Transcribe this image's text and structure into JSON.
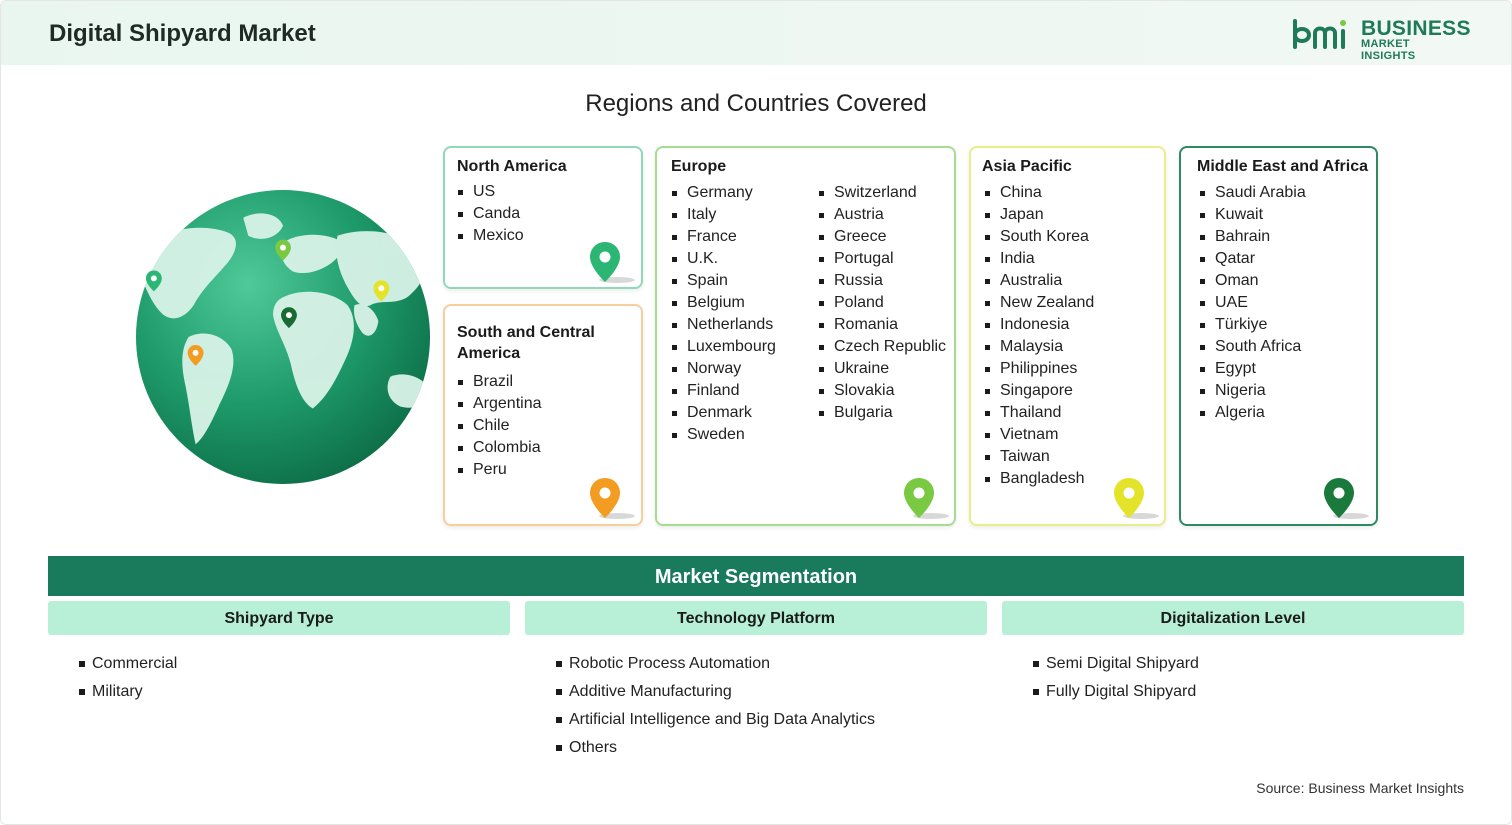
{
  "header": {
    "title": "Digital Shipyard Market",
    "logo_line1": "BUSINESS",
    "logo_line2": "MARKET INSIGHTS"
  },
  "regions_title": "Regions and Countries Covered",
  "regions": {
    "north_america": {
      "title": "North America",
      "items": [
        "US",
        "Canda",
        "Mexico"
      ],
      "pin_color": "#2bb673"
    },
    "south_america": {
      "title": "South and Central America",
      "items": [
        "Brazil",
        "Argentina",
        "Chile",
        "Colombia",
        "Peru"
      ],
      "pin_color": "#f39c22"
    },
    "europe": {
      "title": "Europe",
      "col1": [
        "Germany",
        "Italy",
        "France",
        "U.K.",
        "Spain",
        "Belgium",
        "Netherlands",
        "Luxembourg",
        "Norway",
        "Finland",
        "Denmark",
        "Sweden"
      ],
      "col2": [
        "Switzerland",
        "Austria",
        "Greece",
        "Portugal",
        "Russia",
        "Poland",
        "Romania",
        "Czech Republic",
        "Ukraine",
        "Slovakia",
        "Bulgaria"
      ],
      "pin_color": "#7ac943"
    },
    "asia_pacific": {
      "title": "Asia Pacific",
      "items": [
        "China",
        "Japan",
        "South Korea",
        "India",
        "Australia",
        "New Zealand",
        "Indonesia",
        "Malaysia",
        "Philippines",
        "Singapore",
        "Thailand",
        "Vietnam",
        "Taiwan",
        "Bangladesh"
      ],
      "pin_color": "#e3e32a"
    },
    "mea": {
      "title": "Middle East and Africa",
      "items": [
        "Saudi Arabia",
        "Kuwait",
        "Bahrain",
        "Qatar",
        "Oman",
        "UAE",
        "Türkiye",
        "South Africa",
        "Egypt",
        "Nigeria",
        "Algeria"
      ],
      "pin_color": "#1a7a3c"
    }
  },
  "segmentation": {
    "title": "Market Segmentation",
    "columns": [
      {
        "heading": "Shipyard Type",
        "items": [
          "Commercial",
          "Military"
        ]
      },
      {
        "heading": "Technology Platform",
        "items": [
          "Robotic Process Automation",
          "Additive Manufacturing",
          "Artificial Intelligence and Big Data Analytics",
          "Others"
        ]
      },
      {
        "heading": "Digitalization Level",
        "items": [
          "Semi Digital Shipyard",
          "Fully Digital Shipyard"
        ]
      }
    ]
  },
  "source": "Source: Business Market Insights",
  "colors": {
    "accent": "#1a7a5c",
    "segment_header": "#b7f0d6",
    "card_north_america": "#8fd9b8",
    "card_south_america": "#f6cf9a",
    "card_europe": "#a6dc92",
    "card_asia_pacific": "#e9ed8a",
    "card_mea": "#2f8a64"
  }
}
